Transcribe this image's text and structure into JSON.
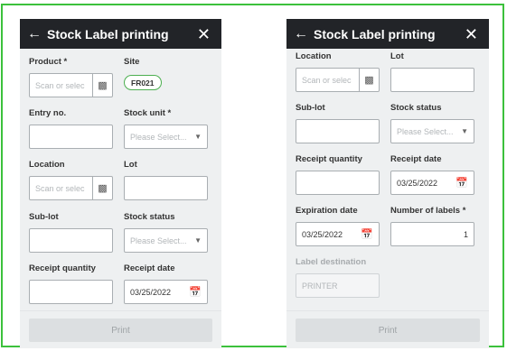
{
  "screens": [
    {
      "header": {
        "title": "Stock Label printing",
        "back_icon": "arrow-left-icon",
        "close_icon": "close-icon"
      },
      "fields": {
        "product": {
          "label": "Product *",
          "placeholder": "Scan or selec"
        },
        "site": {
          "label": "Site",
          "value": "FR021"
        },
        "entry_no": {
          "label": "Entry no.",
          "value": ""
        },
        "stock_unit": {
          "label": "Stock unit *",
          "placeholder": "Please Select..."
        },
        "location": {
          "label": "Location",
          "placeholder": "Scan or selec"
        },
        "lot": {
          "label": "Lot",
          "value": ""
        },
        "sub_lot": {
          "label": "Sub-lot",
          "value": ""
        },
        "stock_status": {
          "label": "Stock status",
          "placeholder": "Please Select..."
        },
        "receipt_quantity": {
          "label": "Receipt quantity",
          "value": ""
        },
        "receipt_date": {
          "label": "Receipt date",
          "value": "03/25/2022"
        }
      },
      "footer": {
        "print_label": "Print"
      }
    },
    {
      "header": {
        "title": "Stock Label printing",
        "back_icon": "arrow-left-icon",
        "close_icon": "close-icon"
      },
      "fields": {
        "location": {
          "label": "Location",
          "placeholder": "Scan or selec"
        },
        "lot": {
          "label": "Lot",
          "value": ""
        },
        "sub_lot": {
          "label": "Sub-lot",
          "value": ""
        },
        "stock_status": {
          "label": "Stock status",
          "placeholder": "Please Select..."
        },
        "receipt_quantity": {
          "label": "Receipt quantity",
          "value": ""
        },
        "receipt_date": {
          "label": "Receipt date",
          "value": "03/25/2022"
        },
        "expiration_date": {
          "label": "Expiration date",
          "value": "03/25/2022"
        },
        "number_of_labels": {
          "label": "Number of labels *",
          "value": "1"
        },
        "label_destination": {
          "label": "Label destination",
          "value": "PRINTER"
        }
      },
      "footer": {
        "print_label": "Print"
      }
    }
  ],
  "colors": {
    "header_bg": "#222428",
    "frame_border": "#3cc13c",
    "badge_border": "#4caf50",
    "panel_bg": "#eef0f1"
  }
}
